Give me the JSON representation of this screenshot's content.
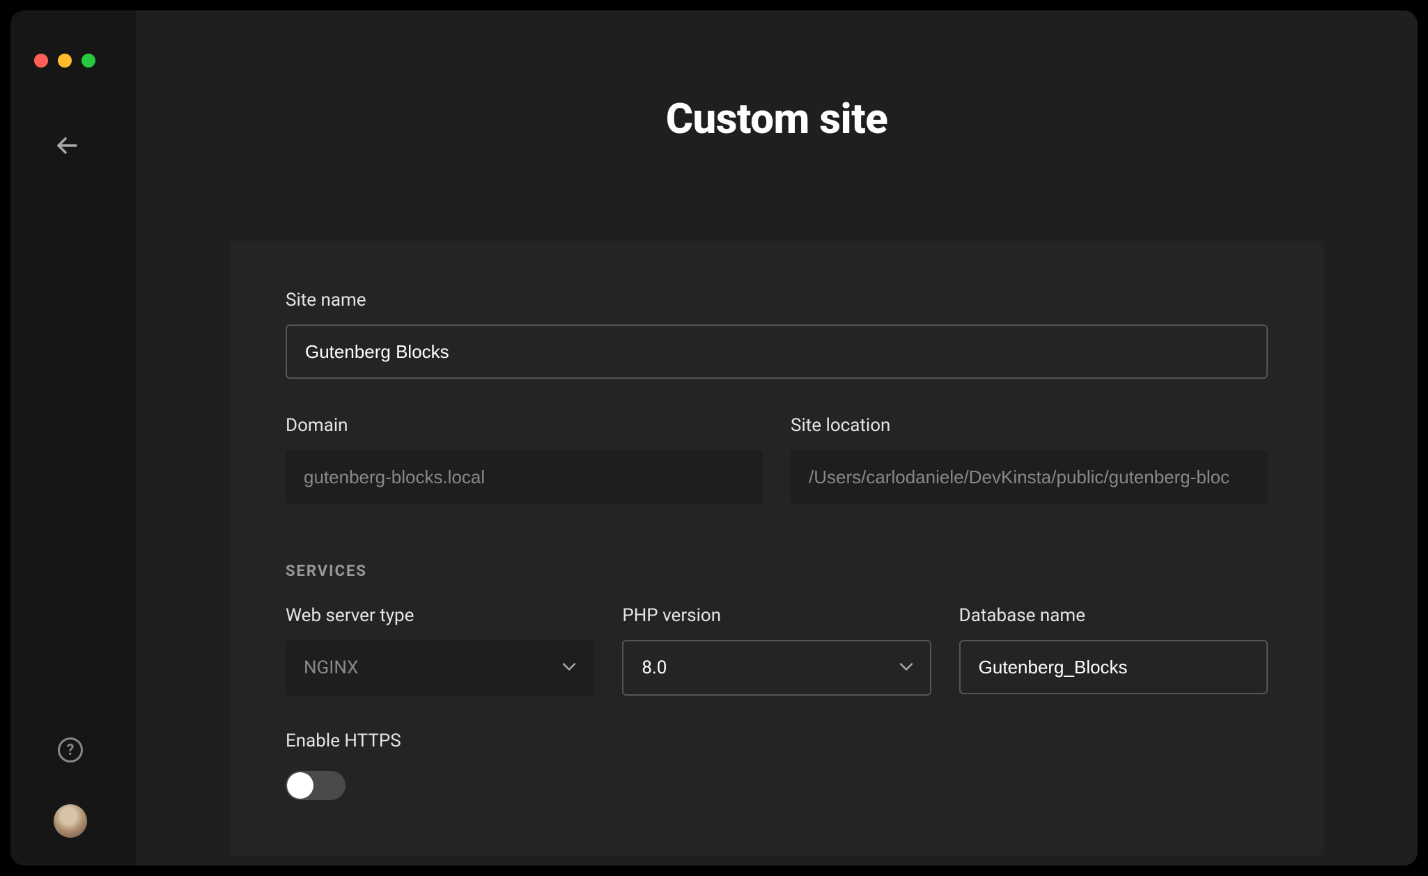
{
  "header": {
    "title": "Custom site"
  },
  "form": {
    "site_name_label": "Site name",
    "site_name_value": "Gutenberg Blocks",
    "domain_label": "Domain",
    "domain_value": "gutenberg-blocks.local",
    "site_location_label": "Site location",
    "site_location_value": "/Users/carlodaniele/DevKinsta/public/gutenberg-bloc",
    "services_heading": "SERVICES",
    "web_server_label": "Web server type",
    "web_server_value": "NGINX",
    "php_version_label": "PHP version",
    "php_version_value": "8.0",
    "database_name_label": "Database name",
    "database_name_value": "Gutenberg_Blocks",
    "https_label": "Enable HTTPS",
    "https_enabled": false
  }
}
